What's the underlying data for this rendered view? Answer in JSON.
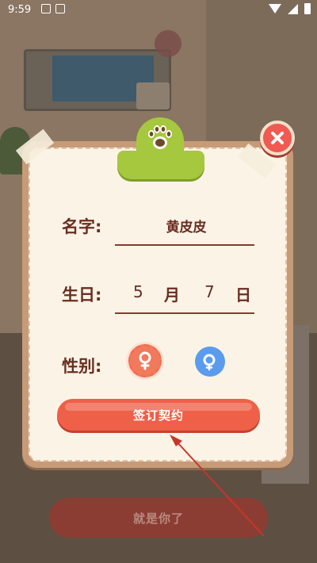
{
  "status_bar": {
    "time": "9:59"
  },
  "background": {
    "button_label": "就是你了"
  },
  "dialog": {
    "name_label": "名字:",
    "name_value": "黄皮皮",
    "birthday_label": "生日:",
    "birthday_month": "5",
    "birthday_month_unit": "月",
    "birthday_day": "7",
    "birthday_day_unit": "日",
    "gender_label": "性别:",
    "gender_options": [
      {
        "icon": "female-icon",
        "color": "#f1795c",
        "selected": true
      },
      {
        "icon": "male-icon",
        "color": "#5b9bee",
        "selected": false
      }
    ],
    "sign_button_label": "签订契约"
  },
  "colors": {
    "accent_red": "#ef6048",
    "clip_green": "#a6c83e",
    "label_brown": "#6b2d22",
    "annotation_arrow": "#c7352b"
  }
}
